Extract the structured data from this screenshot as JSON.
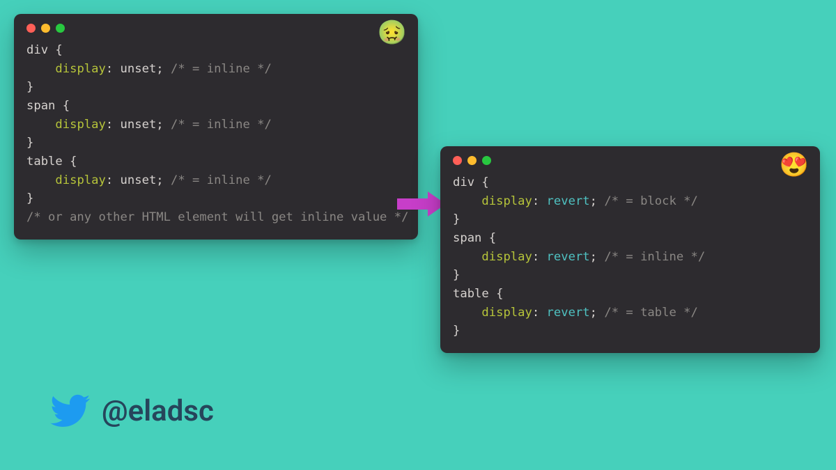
{
  "left": {
    "emoji": "🤢",
    "lines": [
      [
        {
          "t": "div {",
          "c": "sel"
        }
      ],
      [
        {
          "t": "    ",
          "c": "sel"
        },
        {
          "t": "display",
          "c": "prop"
        },
        {
          "t": ": ",
          "c": "punct"
        },
        {
          "t": "unset",
          "c": "val1"
        },
        {
          "t": "; ",
          "c": "punct"
        },
        {
          "t": "/* = inline */",
          "c": "comment"
        }
      ],
      [
        {
          "t": "}",
          "c": "sel"
        }
      ],
      [
        {
          "t": "span {",
          "c": "sel"
        }
      ],
      [
        {
          "t": "    ",
          "c": "sel"
        },
        {
          "t": "display",
          "c": "prop"
        },
        {
          "t": ": ",
          "c": "punct"
        },
        {
          "t": "unset",
          "c": "val1"
        },
        {
          "t": "; ",
          "c": "punct"
        },
        {
          "t": "/* = inline */",
          "c": "comment"
        }
      ],
      [
        {
          "t": "}",
          "c": "sel"
        }
      ],
      [
        {
          "t": "table {",
          "c": "sel"
        }
      ],
      [
        {
          "t": "    ",
          "c": "sel"
        },
        {
          "t": "display",
          "c": "prop"
        },
        {
          "t": ": ",
          "c": "punct"
        },
        {
          "t": "unset",
          "c": "val1"
        },
        {
          "t": "; ",
          "c": "punct"
        },
        {
          "t": "/* = inline */",
          "c": "comment"
        }
      ],
      [
        {
          "t": "}",
          "c": "sel"
        }
      ],
      [
        {
          "t": "/* or any other HTML element will get inline value */",
          "c": "comment"
        }
      ]
    ]
  },
  "right": {
    "emoji": "😍",
    "lines": [
      [
        {
          "t": "div {",
          "c": "sel"
        }
      ],
      [
        {
          "t": "    ",
          "c": "sel"
        },
        {
          "t": "display",
          "c": "prop"
        },
        {
          "t": ": ",
          "c": "punct"
        },
        {
          "t": "revert",
          "c": "val2"
        },
        {
          "t": "; ",
          "c": "punct"
        },
        {
          "t": "/* = block */",
          "c": "comment"
        }
      ],
      [
        {
          "t": "}",
          "c": "sel"
        }
      ],
      [
        {
          "t": "span {",
          "c": "sel"
        }
      ],
      [
        {
          "t": "    ",
          "c": "sel"
        },
        {
          "t": "display",
          "c": "prop"
        },
        {
          "t": ": ",
          "c": "punct"
        },
        {
          "t": "revert",
          "c": "val2"
        },
        {
          "t": "; ",
          "c": "punct"
        },
        {
          "t": "/* = inline */",
          "c": "comment"
        }
      ],
      [
        {
          "t": "}",
          "c": "sel"
        }
      ],
      [
        {
          "t": "table {",
          "c": "sel"
        }
      ],
      [
        {
          "t": "    ",
          "c": "sel"
        },
        {
          "t": "display",
          "c": "prop"
        },
        {
          "t": ": ",
          "c": "punct"
        },
        {
          "t": "revert",
          "c": "val2"
        },
        {
          "t": "; ",
          "c": "punct"
        },
        {
          "t": "/* = table */",
          "c": "comment"
        }
      ],
      [
        {
          "t": "}",
          "c": "sel"
        }
      ]
    ]
  },
  "credit": "@eladsc"
}
